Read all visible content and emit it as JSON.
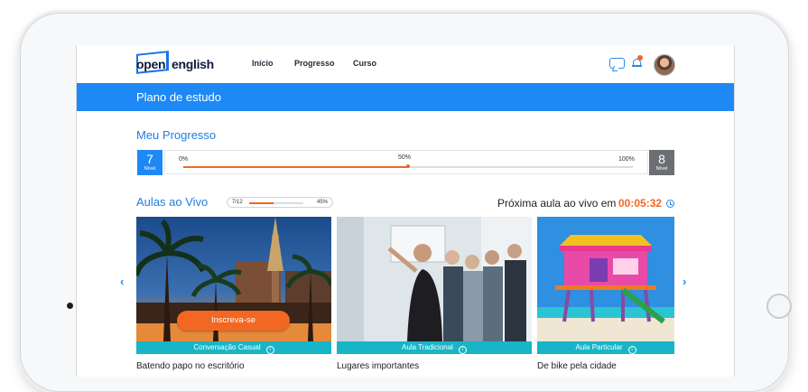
{
  "app": {
    "logo_part1": "open",
    "logo_part2": "english"
  },
  "nav": {
    "items": [
      "Início",
      "Progresso",
      "Curso"
    ],
    "notification_count": "1"
  },
  "header": {
    "title": "Plano de estudo"
  },
  "progress": {
    "section_title": "Meu Progresso",
    "current_level_number": "7",
    "current_level_label": "Nível",
    "next_level_number": "8",
    "next_level_label": "Nível",
    "start_label": "0%",
    "mid_label": "50%",
    "end_label": "100%",
    "value": 0.5
  },
  "live": {
    "section_title": "Aulas ao Vivo",
    "count_text": "7/12",
    "percent_text": "45%",
    "percent_value": 0.45,
    "next_label": "Próxima aula ao vivo em",
    "timer": "00:05:32"
  },
  "cards": [
    {
      "cta": "Inscreva-se",
      "tag": "Conversação Casual",
      "caption": "Batendo papo no escritório"
    },
    {
      "tag": "Aula Tradicional",
      "caption": "Lugares importantes"
    },
    {
      "tag": "Aula Particular",
      "caption": "De bike pela cidade"
    }
  ],
  "colors": {
    "brand_blue": "#1e88f5",
    "accent_orange": "#f26722",
    "tag_teal": "#17b5c7",
    "current_level_bg": "#1e88f5",
    "next_level_bg": "#6b6e72"
  },
  "icons": {
    "chat": "chat-icon",
    "bell": "bell-icon",
    "clock": "clock-icon",
    "info": "info-icon",
    "prev": "chevron-left-icon",
    "next": "chevron-right-icon"
  }
}
